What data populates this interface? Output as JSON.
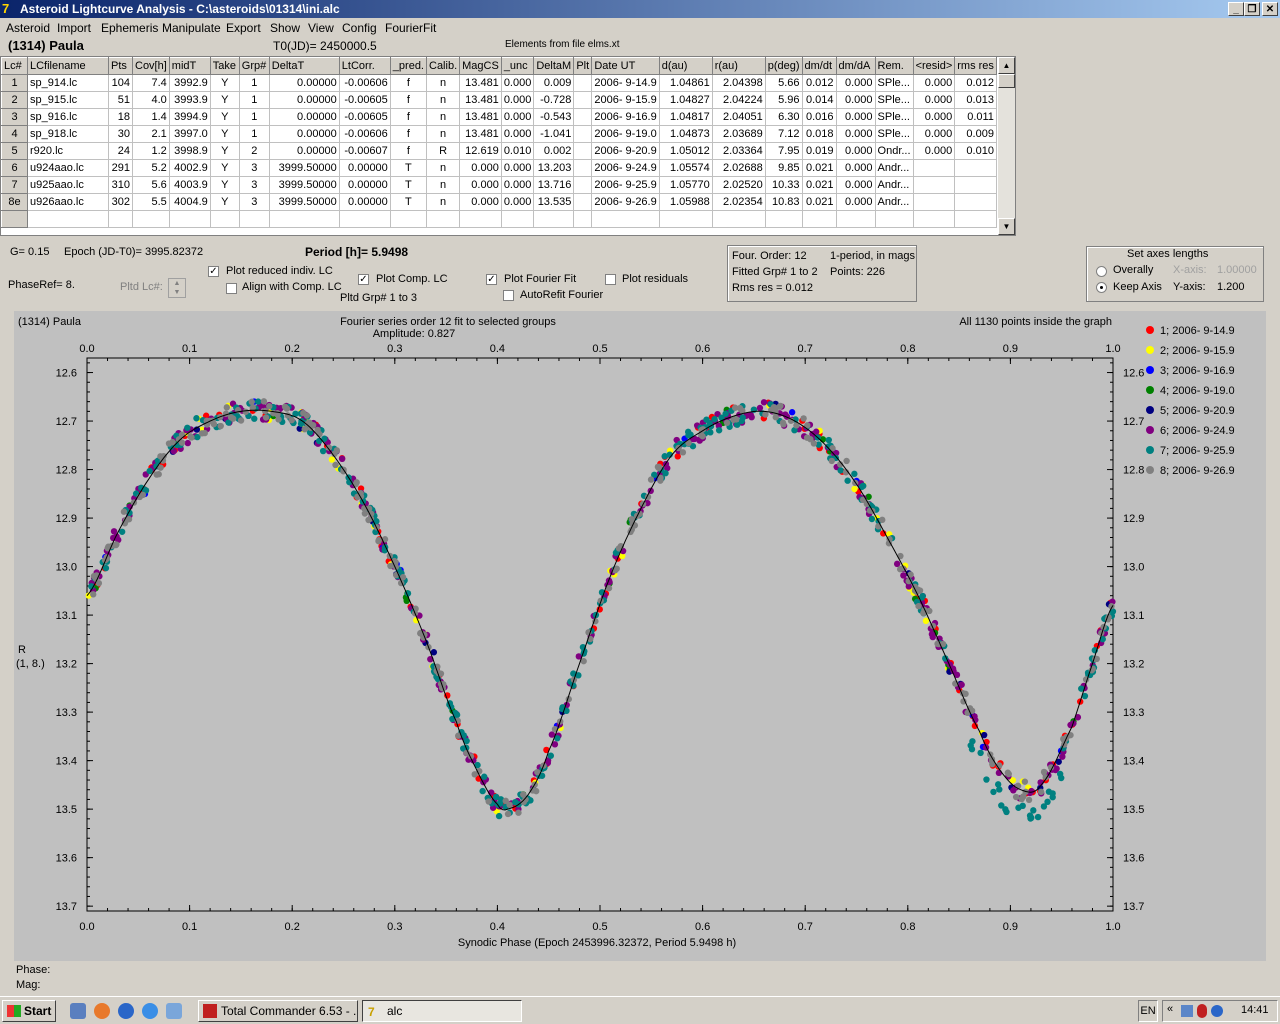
{
  "window": {
    "title": "Asteroid Lightcurve Analysis - C:\\asteroids\\01314\\ini.alc"
  },
  "menu": [
    "Asteroid",
    "Import",
    "Ephemeris",
    "Manipulate",
    "Export",
    "Show",
    "View",
    "Config",
    "FourierFit"
  ],
  "header": {
    "asteroid": "(1314) Paula",
    "t0": "T0(JD)= 2450000.5",
    "elements": "Elements from file elms.xt"
  },
  "table": {
    "columns": [
      "Lc#",
      "LCfilename",
      "Pts",
      "Cov[h]",
      "midT",
      "Take",
      "Grp#",
      "DeltaT",
      "LtCorr.",
      "_pred.",
      "Calib.",
      "MagCS",
      "_unc",
      "DeltaM",
      "Plt",
      "Date UT",
      "d(au)",
      "r(au)",
      "p(deg)",
      "dm/dt",
      "dm/dA",
      "Rem.",
      "<resid>",
      "rms res"
    ],
    "rows": [
      [
        "1",
        "sp_914.lc",
        "104",
        "7.4",
        "3992.9",
        "Y",
        "1",
        "0.00000",
        "-0.00606",
        "f",
        "n",
        "13.481",
        "0.000",
        "0.009",
        "",
        "2006- 9-14.9",
        "1.04861",
        "2.04398",
        "5.66",
        "0.012",
        "0.000",
        "SPle...",
        "0.000",
        "0.012"
      ],
      [
        "2",
        "sp_915.lc",
        "51",
        "4.0",
        "3993.9",
        "Y",
        "1",
        "0.00000",
        "-0.00605",
        "f",
        "n",
        "13.481",
        "0.000",
        "-0.728",
        "",
        "2006- 9-15.9",
        "1.04827",
        "2.04224",
        "5.96",
        "0.014",
        "0.000",
        "SPle...",
        "0.000",
        "0.013"
      ],
      [
        "3",
        "sp_916.lc",
        "18",
        "1.4",
        "3994.9",
        "Y",
        "1",
        "0.00000",
        "-0.00605",
        "f",
        "n",
        "13.481",
        "0.000",
        "-0.543",
        "",
        "2006- 9-16.9",
        "1.04817",
        "2.04051",
        "6.30",
        "0.016",
        "0.000",
        "SPle...",
        "0.000",
        "0.011"
      ],
      [
        "4",
        "sp_918.lc",
        "30",
        "2.1",
        "3997.0",
        "Y",
        "1",
        "0.00000",
        "-0.00606",
        "f",
        "n",
        "13.481",
        "0.000",
        "-1.041",
        "",
        "2006- 9-19.0",
        "1.04873",
        "2.03689",
        "7.12",
        "0.018",
        "0.000",
        "SPle...",
        "0.000",
        "0.009"
      ],
      [
        "5",
        "r920.lc",
        "24",
        "1.2",
        "3998.9",
        "Y",
        "2",
        "0.00000",
        "-0.00607",
        "f",
        "R",
        "12.619",
        "0.010",
        "0.002",
        "",
        "2006- 9-20.9",
        "1.05012",
        "2.03364",
        "7.95",
        "0.019",
        "0.000",
        "Ondr...",
        "0.000",
        "0.010"
      ],
      [
        "6",
        "u924aao.lc",
        "291",
        "5.2",
        "4002.9",
        "Y",
        "3",
        "3999.50000",
        "0.00000",
        "T",
        "n",
        "0.000",
        "0.000",
        "13.203",
        "",
        "2006- 9-24.9",
        "1.05574",
        "2.02688",
        "9.85",
        "0.021",
        "0.000",
        "Andr...",
        "",
        ""
      ],
      [
        "7",
        "u925aao.lc",
        "310",
        "5.6",
        "4003.9",
        "Y",
        "3",
        "3999.50000",
        "0.00000",
        "T",
        "n",
        "0.000",
        "0.000",
        "13.716",
        "",
        "2006- 9-25.9",
        "1.05770",
        "2.02520",
        "10.33",
        "0.021",
        "0.000",
        "Andr...",
        "",
        ""
      ],
      [
        "8e",
        "u926aao.lc",
        "302",
        "5.5",
        "4004.9",
        "Y",
        "3",
        "3999.50000",
        "0.00000",
        "T",
        "n",
        "0.000",
        "0.000",
        "13.535",
        "",
        "2006- 9-26.9",
        "1.05988",
        "2.02354",
        "10.83",
        "0.021",
        "0.000",
        "Andr...",
        "",
        ""
      ],
      [
        "",
        "",
        "",
        "",
        "",
        "",
        "",
        "",
        "",
        "",
        "",
        "",
        "",
        "",
        "",
        "",
        "",
        "",
        "",
        "",
        "",
        "",
        "",
        ""
      ]
    ]
  },
  "controls": {
    "g": "G= 0.15",
    "epoch": "Epoch (JD-T0)= 3995.82372",
    "period": "Period [h]= 5.9498",
    "phaseref": "PhaseRef= 8.",
    "pltd_lc": "Pltd Lc#:",
    "plot_reduced": "Plot reduced indiv. LC",
    "align_comp": "Align with Comp. LC",
    "plot_comp": "Plot Comp. LC",
    "pltd_grp": "Pltd Grp#   1   to   3",
    "plot_fourier": "Plot Fourier Fit",
    "autorefit": "AutoRefit Fourier",
    "plot_residuals": "Plot residuals"
  },
  "fourier_info": {
    "order": "Four. Order: 12",
    "mode": "1-period, in mags",
    "fitted": "Fitted Grp# 1 to 2",
    "points": "Points: 226",
    "rms": "Rms res      = 0.012"
  },
  "axes_box": {
    "title": "Set axes lengths",
    "overally": "Overally",
    "keep": "Keep Axis",
    "xaxis_label": "X-axis:",
    "xaxis_val": "1.00000",
    "yaxis_label": "Y-axis:",
    "yaxis_val": "1.200"
  },
  "plot": {
    "title_left": "(1314) Paula",
    "title_center": "Fourier series order 12 fit to selected groups",
    "amplitude": "Amplitude: 0.827",
    "title_right": "All 1130 points inside the graph",
    "ylabel": "R",
    "ylabel2": "(1, 8.)",
    "xlabel": "Synodic Phase (Epoch 2453996.32372, Period 5.9498 h)",
    "phase_label": "Phase:",
    "mag_label": "Mag:"
  },
  "chart_data": {
    "type": "scatter",
    "xlim": [
      0.0,
      1.0
    ],
    "ylim": [
      13.7,
      12.6
    ],
    "x_ticks": [
      "0.0",
      "0.1",
      "0.2",
      "0.3",
      "0.4",
      "0.5",
      "0.6",
      "0.7",
      "0.8",
      "0.9",
      "1.0"
    ],
    "y_ticks": [
      "12.6",
      "12.7",
      "12.8",
      "12.9",
      "13.0",
      "13.1",
      "13.2",
      "13.3",
      "13.4",
      "13.5",
      "13.6",
      "13.7"
    ],
    "series": [
      {
        "name": "1; 2006- 9-14.9",
        "color": "#ff0000"
      },
      {
        "name": "2; 2006- 9-15.9",
        "color": "#ffff00"
      },
      {
        "name": "3; 2006- 9-16.9",
        "color": "#0000ff"
      },
      {
        "name": "4; 2006- 9-19.0",
        "color": "#008000"
      },
      {
        "name": "5; 2006- 9-20.9",
        "color": "#000080"
      },
      {
        "name": "6; 2006- 9-24.9",
        "color": "#800080"
      },
      {
        "name": "7; 2006- 9-25.9",
        "color": "#008080"
      },
      {
        "name": "8; 2006- 9-26.9",
        "color": "#808080"
      }
    ],
    "fit_curve": {
      "phase": [
        0.0,
        0.03,
        0.06,
        0.09,
        0.12,
        0.15,
        0.18,
        0.21,
        0.24,
        0.27,
        0.3,
        0.33,
        0.36,
        0.38,
        0.4,
        0.41,
        0.43,
        0.45,
        0.48,
        0.51,
        0.54,
        0.57,
        0.6,
        0.63,
        0.66,
        0.69,
        0.72,
        0.75,
        0.78,
        0.81,
        0.84,
        0.87,
        0.89,
        0.91,
        0.93,
        0.96,
        0.98,
        1.0
      ],
      "mag": [
        13.06,
        12.93,
        12.82,
        12.74,
        12.7,
        12.68,
        12.68,
        12.7,
        12.77,
        12.87,
        13.0,
        13.15,
        13.32,
        13.42,
        13.49,
        13.5,
        13.47,
        13.38,
        13.2,
        13.02,
        12.88,
        12.77,
        12.72,
        12.69,
        12.68,
        12.7,
        12.75,
        12.83,
        12.94,
        13.06,
        13.2,
        13.34,
        13.42,
        13.46,
        13.45,
        13.33,
        13.2,
        13.08
      ]
    }
  },
  "taskbar": {
    "start": "Start",
    "tasks": [
      "Total Commander 6.53 - ...",
      "alc"
    ],
    "lang": "EN",
    "clock": "14:41"
  }
}
